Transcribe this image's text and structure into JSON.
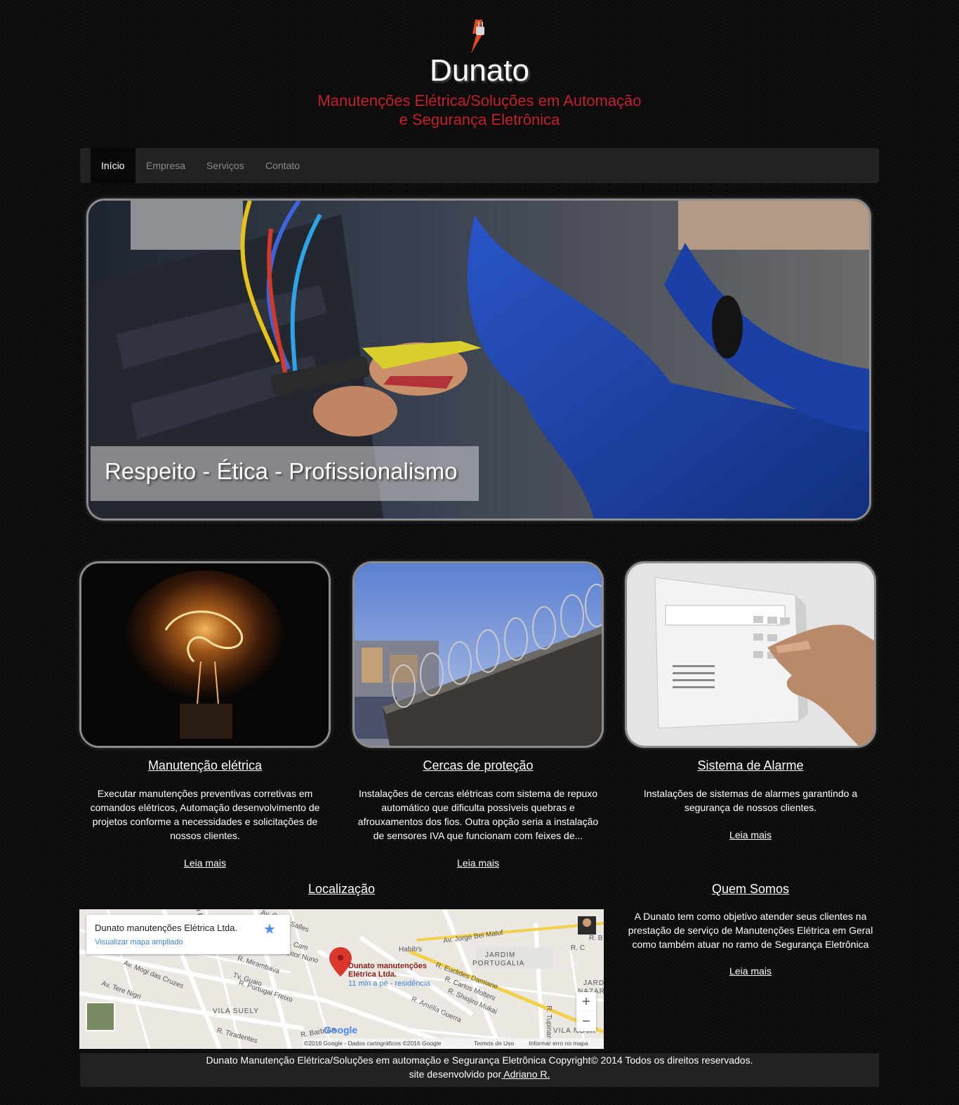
{
  "header": {
    "brand": "Dunato",
    "tagline_line1": "Manutenções Elétrica/Soluções em Automação",
    "tagline_line2": "e Segurança Eletrônica",
    "logo_icon": "plug-lightning-icon"
  },
  "nav": {
    "items": [
      "Início",
      "Empresa",
      "Serviços",
      "Contato"
    ],
    "active": "Início"
  },
  "hero": {
    "caption": "Respeito - Ética - Profissionalismo"
  },
  "features": [
    {
      "title": "Manutenção elétrica",
      "text": "Executar manutenções preventivas corretivas em comandos elétricos, Automação desenvolvimento de projetos conforme a necessidades e solicitações de nossos clientes.",
      "link": "Leia mais"
    },
    {
      "title": "Cercas de proteção",
      "text": "Instalações de cercas elétricas com sistema de repuxo automático que dificulta possíveis quebras e afrouxamentos dos fios. Outra opção seria a instalação de sensores IVA que funcionam com feixes de...",
      "link": "Leia mais"
    },
    {
      "title": "Sistema de Alarme",
      "text": "Instalações de sistemas de alarmes garantindo a segurança de nossos clientes.",
      "link": "Leia mais"
    }
  ],
  "location": {
    "title": "Localização",
    "map_name": "Dunato manutenções Elétrica Ltda.",
    "map_link": "Visualizar mapa ampliado",
    "pin_label_1": "Dunato manutenções",
    "pin_label_2": "Elétrica Ltda.",
    "pin_sub": "11 min a pé - residência",
    "streets": [
      "Av. Jorge Bei Maluf",
      "Habib's",
      "JARDIM",
      "PORTUGALIA",
      "R. Mirambava",
      "Av. Mogi das Cruzes",
      "Av. Tere Nigri",
      "Tv. Guaio",
      "R. Portugal Freixo",
      "VILA SUELY",
      "R. Euclides Damiane",
      "R. Carlos Molteni",
      "R. Shiojiro Mukai",
      "R. Amélia Guerra",
      "R. Tiradentes",
      "R. Barbosa",
      "Salles",
      "R. Tupinamb",
      "VILA NOVA",
      "JARD",
      "NAZAR",
      "Av. Cam",
      "R. Heitor Nuno",
      "R. Cam",
      "Luíza Ferreira",
      "R. C",
      "R. B"
    ],
    "footer_copyright": "©2016 Google - Dados cartográficos ©2016 Google",
    "footer_terms": "Termos de Uso",
    "footer_report": "Informar erro no mapa",
    "google": "Google",
    "zoom_in": "+",
    "zoom_out": "−"
  },
  "about": {
    "title": "Quem Somos",
    "text": "A Dunato tem como objetivo atender seus clientes na prestação de serviço de Manutenções Elétrica em Geral como também atuar no ramo de Segurança Eletrônica",
    "link": "Leia mais"
  },
  "footer": {
    "line1": "Dunato Manutenção Elétrica/Soluções em automação e Segurança Eletrônica Copyright© 2014 Todos os direitos reservados.",
    "line2_prefix": "site desenvolvido por",
    "author": " Adriano R."
  },
  "colors": {
    "accent_red": "#c8212a",
    "nav_bg": "#222222",
    "page_bg": "#0b0b0b",
    "map_link_blue": "#3a84df"
  }
}
